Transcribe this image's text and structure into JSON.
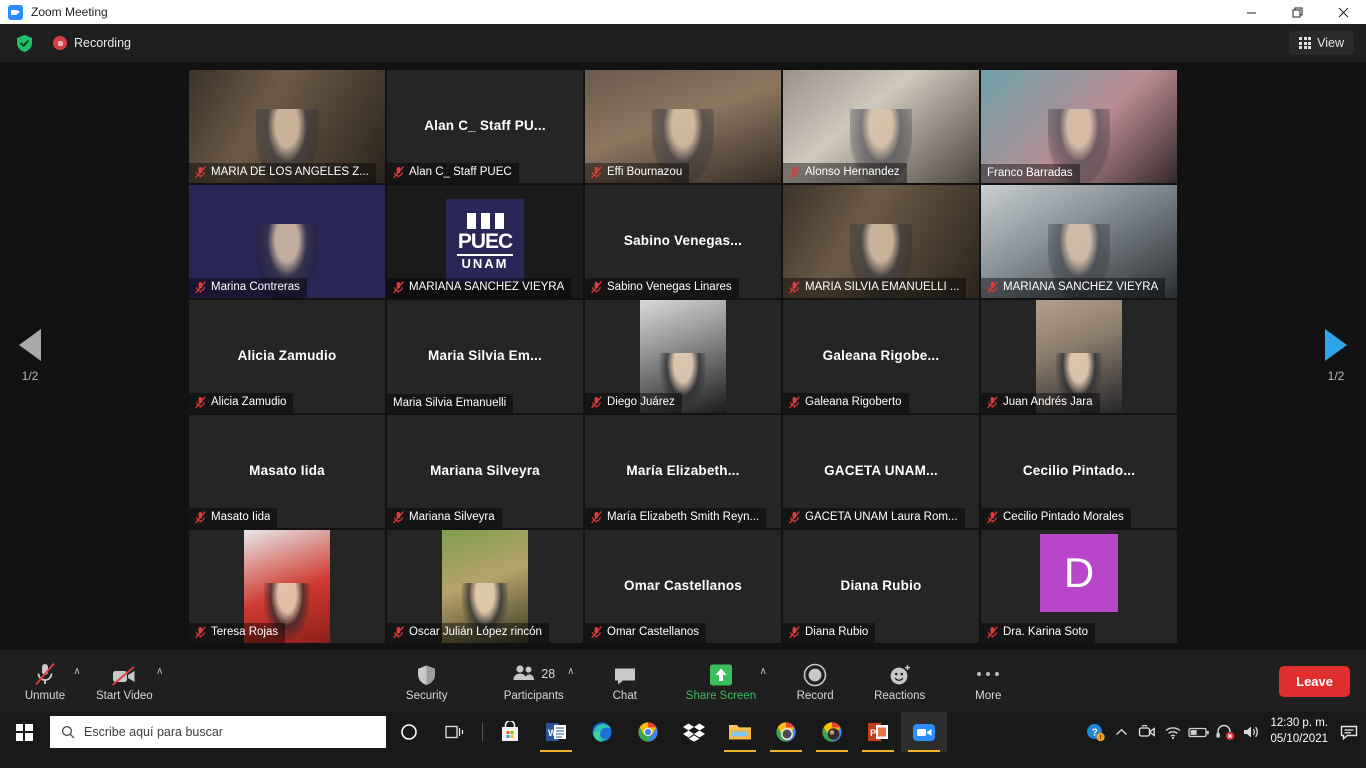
{
  "window": {
    "title": "Zoom Meeting",
    "app_icon": "zoom-camera-icon",
    "minimize_glyph": "—",
    "maximize_glyph": "❐",
    "close_glyph": "✕"
  },
  "topbar": {
    "encryption_icon": "shield-check-icon",
    "recording_label": "Recording",
    "view_label": "View",
    "view_icon": "grid-icon"
  },
  "gallery": {
    "prev_icon": "chevron-left-icon",
    "next_icon": "chevron-right-icon",
    "page_indicator_left": "1/2",
    "page_indicator_right": "1/2",
    "active_border_color": "#e8e84a",
    "mic_muted_icon": "microphone-muted-icon",
    "participants": [
      {
        "label": "MARIA DE LOS ANGELES Z...",
        "center_name": "",
        "muted": true,
        "video": true,
        "active": false,
        "tint": "#5b4a3a"
      },
      {
        "label": "Alan C_ Staff PUEC",
        "center_name": "Alan C_ Staff PU...",
        "muted": true,
        "video": false,
        "active": false,
        "tint": ""
      },
      {
        "label": "Effi Bournazou",
        "center_name": "",
        "muted": true,
        "video": true,
        "active": false,
        "tint": "#9aa3a8"
      },
      {
        "label": "Alonso Hernandez",
        "center_name": "",
        "muted": true,
        "video": true,
        "active": false,
        "tint": "#6b5a4c"
      },
      {
        "label": "Franco Barradas",
        "center_name": "",
        "muted": false,
        "video": true,
        "active": true,
        "tint": "#7d7468"
      },
      {
        "label": "Marina Contreras",
        "center_name": "",
        "muted": true,
        "video": true,
        "active": false,
        "tint": "#7fa6ab"
      },
      {
        "label": "MARIANA SANCHEZ VIEYRA",
        "center_name": "",
        "muted": true,
        "video": true,
        "active": false,
        "tint": "#2a2656",
        "logo": "PUEC"
      },
      {
        "label": "Sabino Venegas Linares",
        "center_name": "Sabino  Venegas...",
        "muted": true,
        "video": false,
        "active": false,
        "tint": ""
      },
      {
        "label": "MARIA SILVIA EMANUELLI ...",
        "center_name": "",
        "muted": true,
        "video": true,
        "active": false,
        "tint": "#8c7e6e"
      },
      {
        "label": "MARIANA SANCHEZ VIEYRA",
        "center_name": "",
        "muted": true,
        "video": true,
        "active": false,
        "tint": "#6f5b45"
      },
      {
        "label": "Alicia Zamudio",
        "center_name": "Alicia Zamudio",
        "muted": true,
        "video": false,
        "active": false,
        "tint": ""
      },
      {
        "label": "Maria Silvia Emanuelli",
        "center_name": "Maria  Silvia  Em...",
        "muted": false,
        "video": false,
        "active": false,
        "tint": ""
      },
      {
        "label": "Diego Juárez",
        "center_name": "",
        "muted": true,
        "video": false,
        "active": false,
        "tint": "",
        "avatar_photo": "grayscale-portrait"
      },
      {
        "label": "Galeana Rigoberto",
        "center_name": "Galeana  Rigobe...",
        "muted": true,
        "video": false,
        "active": false,
        "tint": ""
      },
      {
        "label": "Juan Andrés Jara",
        "center_name": "",
        "muted": true,
        "video": false,
        "active": false,
        "tint": "",
        "avatar_photo": "stone-wall-portrait"
      },
      {
        "label": "Masato Iida",
        "center_name": "Masato Iida",
        "muted": true,
        "video": false,
        "active": false,
        "tint": ""
      },
      {
        "label": "Mariana Silveyra",
        "center_name": "Mariana Silveyra",
        "muted": true,
        "video": false,
        "active": false,
        "tint": ""
      },
      {
        "label": "María Elizabeth Smith Reyn...",
        "center_name": "María  Elizabeth...",
        "muted": true,
        "video": false,
        "active": false,
        "tint": ""
      },
      {
        "label": "GACETA UNAM Laura Rom...",
        "center_name": "GACETA  UNAM...",
        "muted": true,
        "video": false,
        "active": false,
        "tint": ""
      },
      {
        "label": "Cecilio Pintado Morales",
        "center_name": "Cecilio  Pintado...",
        "muted": true,
        "video": false,
        "active": false,
        "tint": ""
      },
      {
        "label": "Teresa Rojas",
        "center_name": "",
        "muted": true,
        "video": false,
        "active": false,
        "tint": "",
        "avatar_photo": "red-backdrop-couple"
      },
      {
        "label": "Oscar Julián López rincón",
        "center_name": "",
        "muted": true,
        "video": false,
        "active": false,
        "tint": "",
        "avatar_photo": "outdoor-portrait"
      },
      {
        "label": "Omar Castellanos",
        "center_name": "Omar Castellanos",
        "muted": true,
        "video": false,
        "active": false,
        "tint": ""
      },
      {
        "label": "Diana Rubio",
        "center_name": "Diana Rubio",
        "muted": true,
        "video": false,
        "active": false,
        "tint": ""
      },
      {
        "label": "Dra. Karina Soto",
        "center_name": "",
        "muted": true,
        "video": false,
        "active": false,
        "tint": "",
        "avatar_initial": "D",
        "avatar_color": "#b846c9"
      }
    ]
  },
  "toolbar": {
    "unmute_label": "Unmute",
    "unmute_icon": "microphone-muted-icon",
    "start_video_label": "Start Video",
    "start_video_icon": "camera-off-icon",
    "security_label": "Security",
    "security_icon": "shield-icon",
    "participants_label": "Participants",
    "participants_icon": "people-icon",
    "participants_count": "28",
    "chat_label": "Chat",
    "chat_icon": "chat-bubble-icon",
    "share_screen_label": "Share Screen",
    "share_screen_icon": "share-arrow-up-icon",
    "share_screen_color": "#3dbd5e",
    "record_label": "Record",
    "record_icon": "record-circle-icon",
    "reactions_label": "Reactions",
    "reactions_icon": "smiley-plus-icon",
    "more_label": "More",
    "more_icon": "ellipsis-icon",
    "leave_label": "Leave",
    "leave_color": "#e02d2d",
    "caret_glyph": "∧"
  },
  "taskbar": {
    "start_icon": "windows-logo-icon",
    "search_placeholder": "Escribe aquí para buscar",
    "search_icon": "search-icon",
    "items": [
      {
        "name": "cortana-icon"
      },
      {
        "name": "task-view-icon"
      },
      {
        "name": "microsoft-store-icon"
      },
      {
        "name": "word-icon"
      },
      {
        "name": "edge-icon"
      },
      {
        "name": "chrome-icon"
      },
      {
        "name": "dropbox-icon"
      },
      {
        "name": "file-explorer-icon"
      },
      {
        "name": "chrome-window-icon"
      },
      {
        "name": "chrome-window-2-icon"
      },
      {
        "name": "powerpoint-icon"
      },
      {
        "name": "zoom-icon"
      }
    ],
    "tray": {
      "help_icon": "help-warning-icon",
      "overflow_icon": "chevron-up-icon",
      "zoom_tray_icon": "zoom-camera-icon",
      "wifi_icon": "wifi-icon",
      "battery_icon": "battery-icon",
      "headset_icon": "headset-muted-icon",
      "volume_icon": "volume-icon",
      "time": "12:30 p. m.",
      "date": "05/10/2021",
      "notifications_icon": "notifications-icon"
    }
  }
}
